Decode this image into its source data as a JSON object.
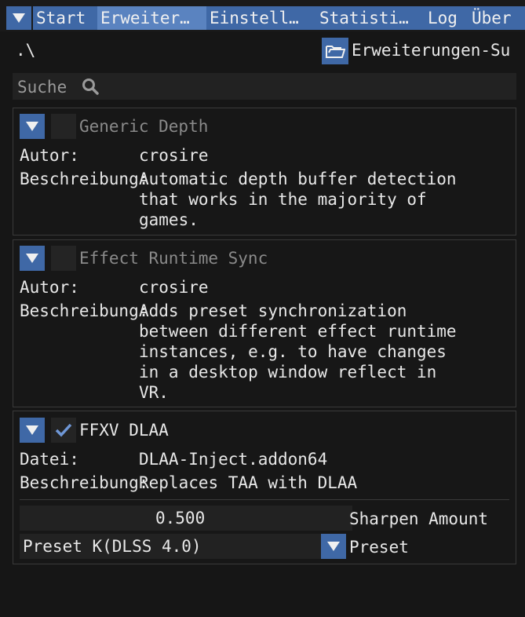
{
  "menu": {
    "tabs": [
      {
        "label": "Start"
      },
      {
        "label": "Erweiter…"
      },
      {
        "label": "Einstell…"
      },
      {
        "label": "Statisti…"
      },
      {
        "label": "Log"
      },
      {
        "label": "Über"
      }
    ],
    "active_tab": "Erweiter…"
  },
  "toolbar": {
    "path": ".\\",
    "folder_label": "Erweiterungen-Su"
  },
  "search": {
    "placeholder": "Suche"
  },
  "addons": [
    {
      "name": "Generic Depth",
      "enabled": false,
      "author_label": "Autor:",
      "author": "crosire",
      "desc_label": "Beschreibung:",
      "description_lines": [
        "Automatic depth buffer detection",
        "that works in the majority of",
        "games."
      ]
    },
    {
      "name": "Effect Runtime Sync",
      "enabled": false,
      "author_label": "Autor:",
      "author": "crosire",
      "desc_label": "Beschreibung:",
      "description_lines": [
        "Adds preset synchronization",
        "between different effect runtime",
        "instances, e.g. to have changes",
        "in a desktop window reflect in",
        "VR."
      ]
    },
    {
      "name": "FFXV DLAA",
      "enabled": true,
      "file_label": "Datei:",
      "file": "DLAA-Inject.addon64",
      "desc_label": "Beschreibung:",
      "description": "Replaces TAA with DLAA",
      "sharpen_value": "0.500",
      "sharpen_label": "Sharpen Amount",
      "preset_value": "Preset K(DLSS 4.0)",
      "preset_label": "Preset"
    }
  ],
  "colors": {
    "accent": "#3f68a6",
    "accent_active": "#5a83c0",
    "background": "#161616",
    "field": "#222222",
    "check": "#6f97d6"
  },
  "icons": {
    "collapse": "triangle-down-icon",
    "folder": "folder-icon",
    "search": "search-icon",
    "check": "checkmark-icon"
  }
}
